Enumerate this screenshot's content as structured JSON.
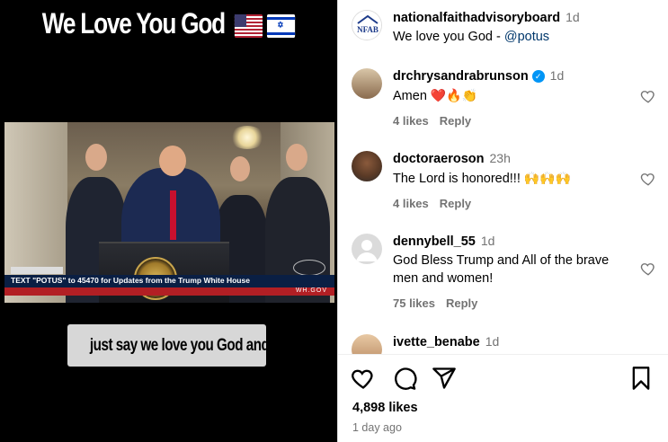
{
  "video": {
    "title": "We Love You God",
    "flags": [
      "us-flag",
      "israel-flag"
    ],
    "lower_third": "TEXT \"POTUS\" to 45470 for Updates from the Trump White House",
    "watermark": "WH.GOV",
    "caption": "just say we love you God and"
  },
  "post": {
    "author": "nationalfaithadvisoryboard",
    "avatar_text": "NFAB",
    "time": "1d",
    "text_prefix": "We love you God - ",
    "mention": "@potus"
  },
  "comments": [
    {
      "username": "drchrysandrabrunson",
      "verified": true,
      "time": "1d",
      "text": "Amen",
      "emoji": "❤️🔥👏",
      "likes": "4 likes",
      "reply": "Reply"
    },
    {
      "username": "doctoraeroson",
      "verified": false,
      "time": "23h",
      "text": "The Lord is honored!!!",
      "emoji": "🙌🙌🙌",
      "likes": "4 likes",
      "reply": "Reply"
    },
    {
      "username": "dennybell_55",
      "verified": false,
      "time": "1d",
      "text": "God Bless Trump and All of the brave men and women!",
      "emoji": "",
      "likes": "75 likes",
      "reply": "Reply"
    },
    {
      "username": "ivette_benabe",
      "verified": false,
      "time": "1d",
      "text": "",
      "emoji": "",
      "likes": "",
      "reply": ""
    }
  ],
  "actions": {
    "icons": [
      "heart-icon",
      "comment-icon",
      "share-icon",
      "bookmark-icon"
    ],
    "like_count": "4,898 likes",
    "posted": "1 day ago"
  },
  "colors": {
    "link": "#00376b",
    "muted": "#737373",
    "verified": "#0095f6"
  }
}
